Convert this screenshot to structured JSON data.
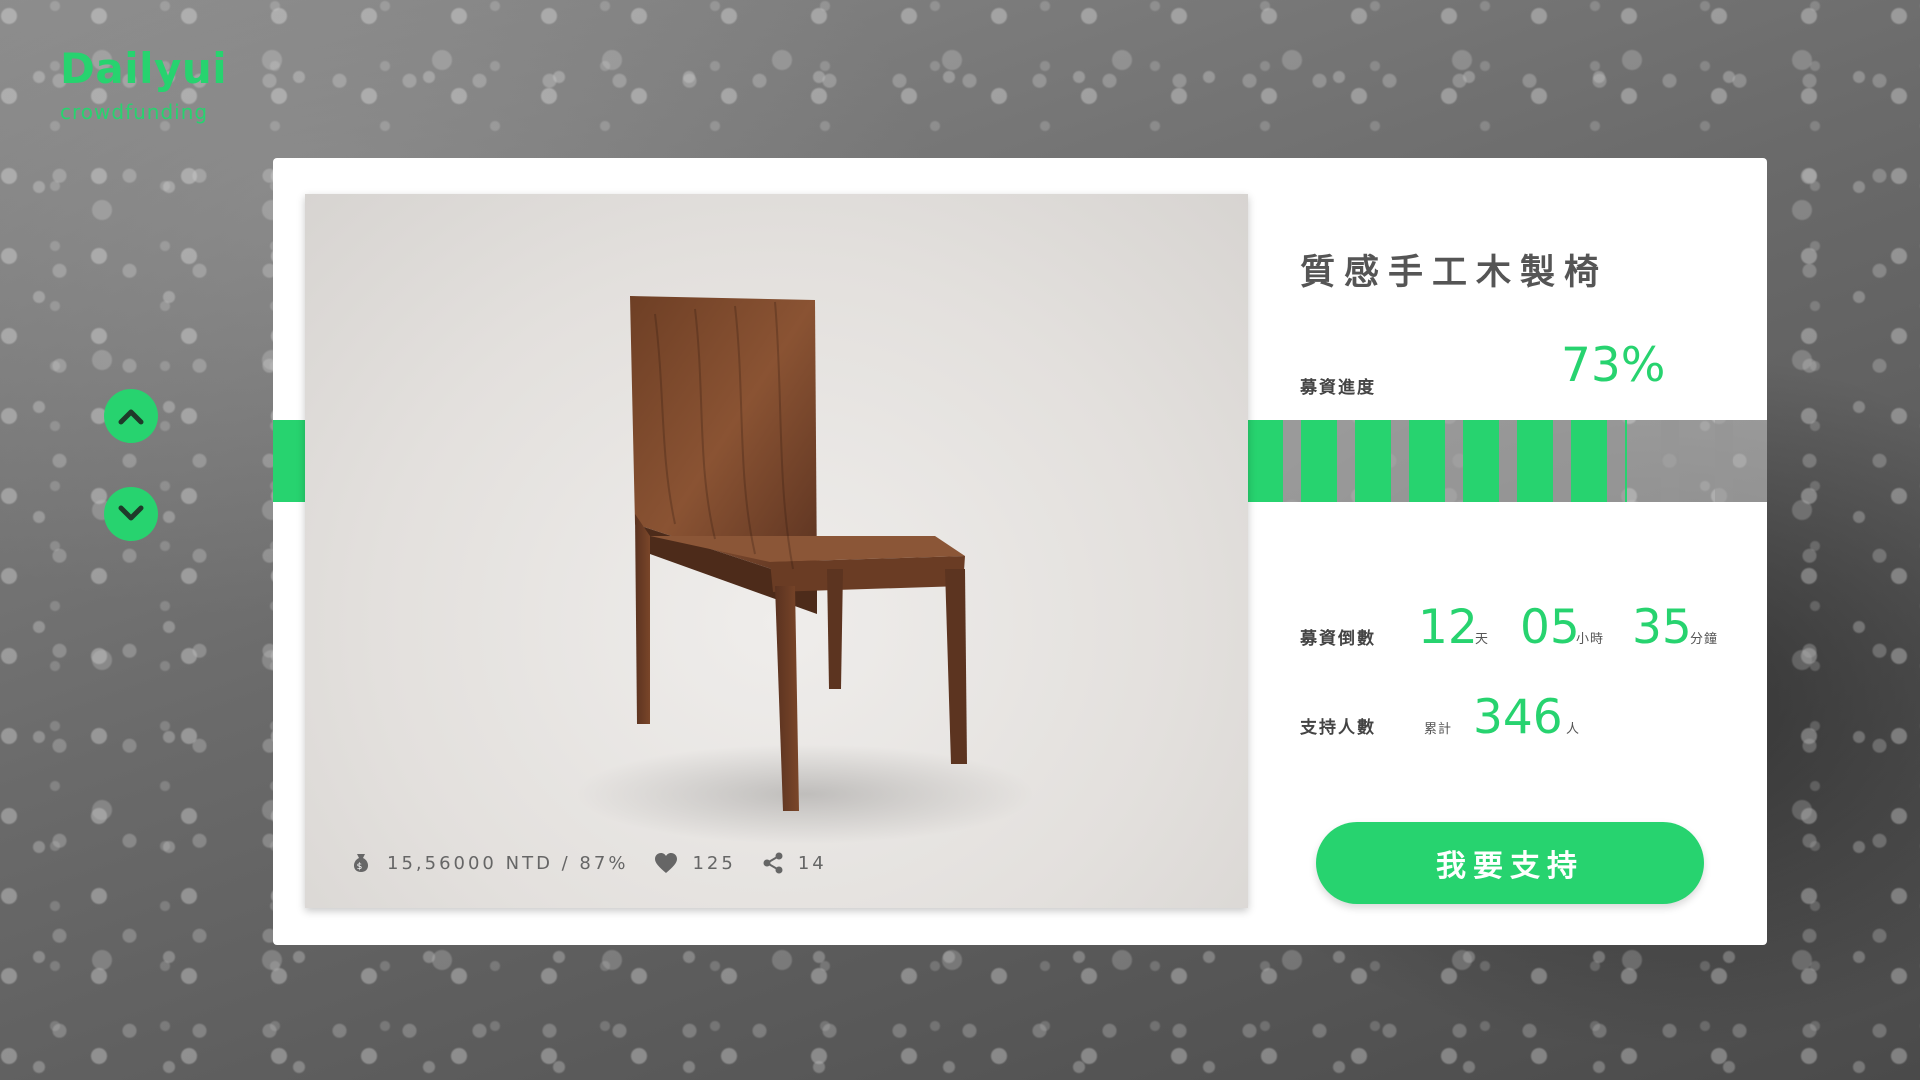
{
  "brand": {
    "title": "Dailyui",
    "subtitle": "crowdfunding"
  },
  "nav": {
    "up_icon": "chevron-up-icon",
    "down_icon": "chevron-down-icon"
  },
  "product": {
    "title": "質感手工木製椅",
    "image_icon": "wooden-chair-image"
  },
  "stats": {
    "funding_text": "15,56000 NTD / 87%",
    "likes": "125",
    "shares": "14",
    "icons": [
      "money-bag-icon",
      "heart-icon",
      "share-icon"
    ]
  },
  "progress": {
    "label": "募資進度",
    "percent_text": "73%",
    "fill_fraction": 0.73
  },
  "countdown": {
    "label": "募資倒數",
    "days": "12",
    "days_unit": "天",
    "hours": "05",
    "hours_unit": "小時",
    "minutes": "35",
    "minutes_unit": "分鐘"
  },
  "supporters": {
    "label": "支持人數",
    "prefix": "累計",
    "count": "346",
    "unit": "人"
  },
  "cta": {
    "label": "我要支持"
  },
  "colors": {
    "accent": "#27d36f",
    "card": "#ffffff",
    "text_dark": "#555555"
  }
}
